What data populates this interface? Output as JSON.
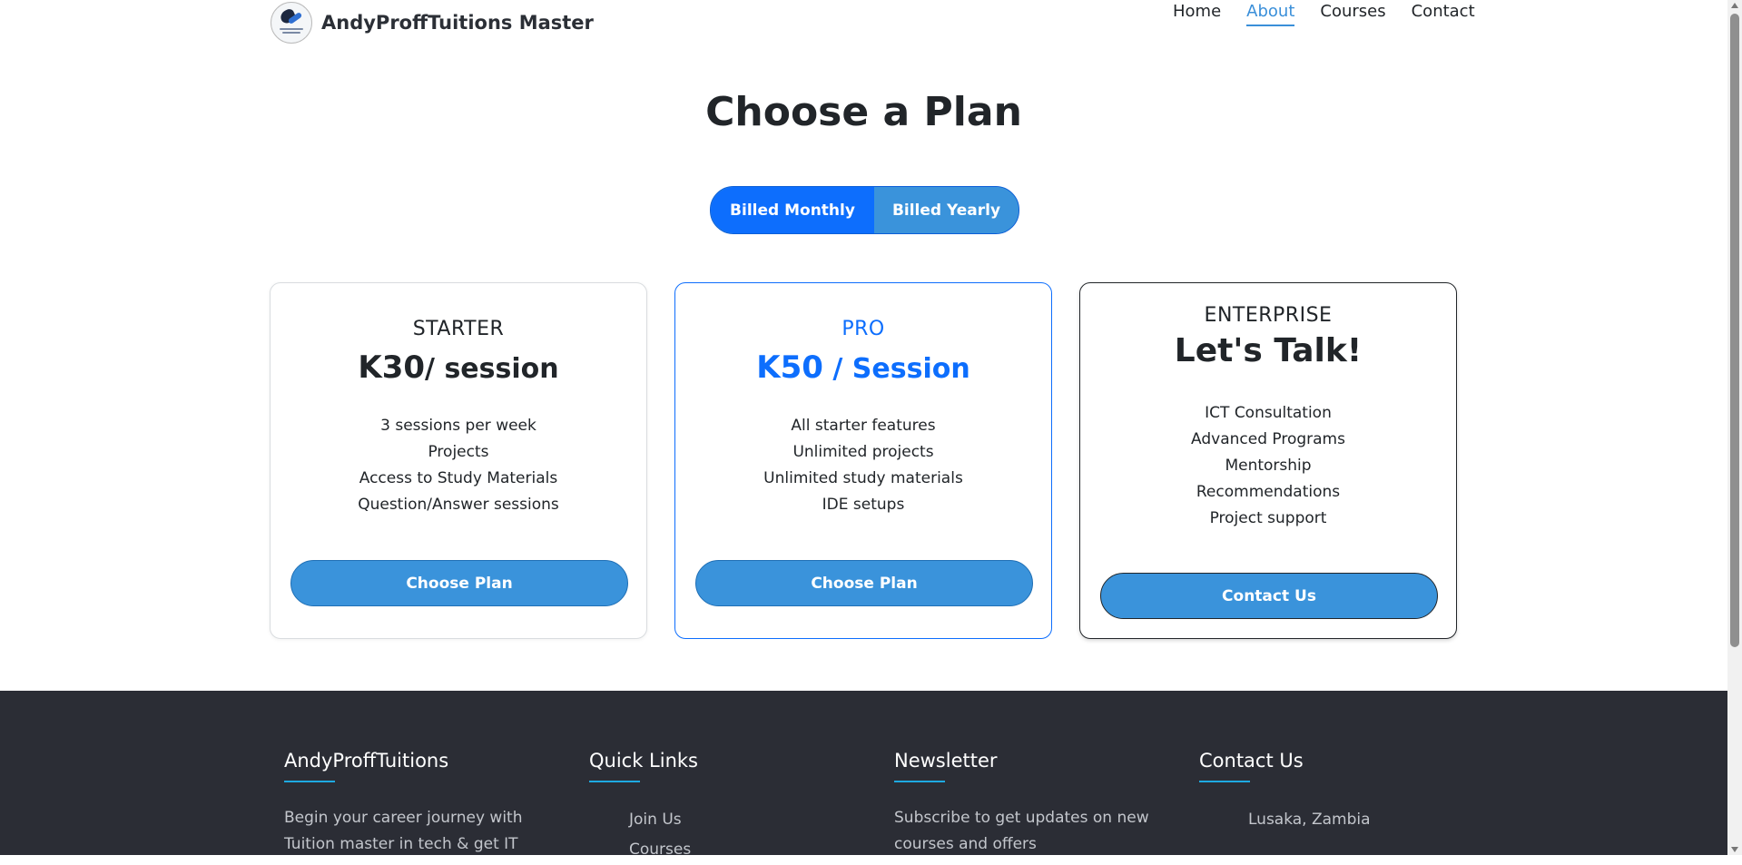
{
  "header": {
    "brand": "AndyProffTuitions Master",
    "nav": [
      {
        "label": "Home",
        "active": false
      },
      {
        "label": "About",
        "active": true
      },
      {
        "label": "Courses",
        "active": false
      },
      {
        "label": "Contact",
        "active": false
      }
    ]
  },
  "main": {
    "title": "Choose a Plan",
    "billing_toggle": {
      "monthly": "Billed Monthly",
      "yearly": "Billed Yearly",
      "selected": "monthly"
    },
    "plans": [
      {
        "tier": "STARTER",
        "price": "K30",
        "per": "/ session",
        "features": [
          "3 sessions per week",
          "Projects",
          "Access to Study Materials",
          "Question/Answer sessions"
        ],
        "button": "Choose Plan"
      },
      {
        "tier": "PRO",
        "price": "K50",
        "per": " / Session",
        "features": [
          "All starter features",
          "Unlimited projects",
          "Unlimited study materials",
          "IDE setups"
        ],
        "button": "Choose Plan"
      },
      {
        "tier": "ENTERPRISE",
        "price": "Let's Talk!",
        "features": [
          "ICT Consultation",
          "Advanced Programs",
          "Mentorship",
          "Recommendations",
          "Project support"
        ],
        "button": "Contact Us"
      }
    ]
  },
  "footer": {
    "about": {
      "title": "AndyProffTuitions",
      "text": "Begin your career journey with Tuition master in tech & get IT"
    },
    "quick_links": {
      "title": "Quick Links",
      "items": [
        "Join Us",
        "Courses"
      ]
    },
    "newsletter": {
      "title": "Newsletter",
      "text": "Subscribe to get updates on new courses and offers"
    },
    "contact": {
      "title": "Contact Us",
      "items": [
        "Lusaka, Zambia"
      ]
    }
  },
  "colors": {
    "primary": "#0d6efd",
    "button": "#3a93db",
    "footer_bg": "#2b2d35",
    "accent_underline": "#1ea9e1"
  }
}
